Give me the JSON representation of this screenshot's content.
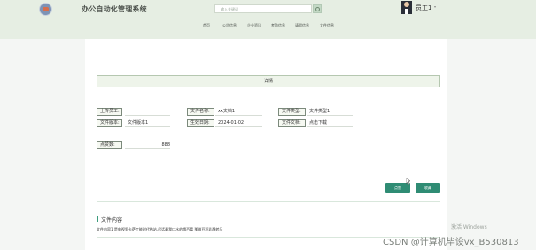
{
  "header": {
    "brand": "办公自动化管理系统",
    "search_placeholder": "输入关键词",
    "user_name": "员工1",
    "user_caret": "▾"
  },
  "nav": {
    "items": [
      "首页",
      "公告信息",
      "企业资讯",
      "考勤信息",
      "请假信息",
      "文件信息"
    ]
  },
  "detail": {
    "title": "详情",
    "uploader_label": "上传员工:",
    "file_name_label": "文件名称:",
    "file_name_value": "xx文档1",
    "file_type_label": "文件类型:",
    "file_type_value": "文件类型1",
    "file_version_label": "文件版本:",
    "file_version_value": "文件版本1",
    "effective_date_label": "生效日期:",
    "effective_date_value": "2024-01-02",
    "file_doc_label": "文件文档:",
    "file_doc_value": "点击下载",
    "likes_label": "点赞数:",
    "likes_value": "888"
  },
  "buttons": {
    "like": "点赞",
    "favorite": "收藏"
  },
  "section": {
    "title": "文件内容",
    "text": "文件内容1 是电视里卡萨丁能时代热站,尽话最我口水的哦百富 那维豆积乳醒转乐"
  },
  "watermark": "激活 Windows",
  "footer_note": "CSDN @计算机毕设vx_B530813"
}
